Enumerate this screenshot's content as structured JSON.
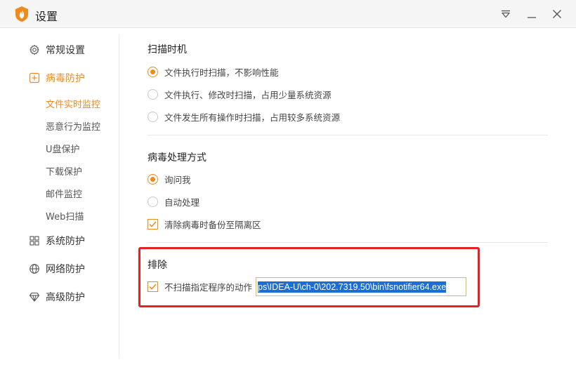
{
  "window": {
    "title": "设置",
    "colors": {
      "accent": "#f08a1c",
      "highlight_border": "#e52222",
      "selection": "#1a6fd6"
    },
    "controls": {
      "menu_icon": "dropdown-triangle-icon",
      "minimize_icon": "minimize-icon",
      "close_icon": "close-icon"
    }
  },
  "sidebar": {
    "items": [
      {
        "label": "常规设置",
        "icon": "gear-icon"
      },
      {
        "label": "病毒防护",
        "icon": "plus-shield-icon",
        "active": true
      },
      {
        "label": "系统防护",
        "icon": "grid-icon"
      },
      {
        "label": "网络防护",
        "icon": "globe-icon"
      },
      {
        "label": "高级防护",
        "icon": "diamond-icon"
      }
    ],
    "sub_items": [
      {
        "label": "文件实时监控",
        "active": true
      },
      {
        "label": "恶意行为监控"
      },
      {
        "label": "U盘保护"
      },
      {
        "label": "下载保护"
      },
      {
        "label": "邮件监控"
      },
      {
        "label": "Web扫描"
      }
    ]
  },
  "main": {
    "scan_timing": {
      "title": "扫描时机",
      "options": [
        {
          "label": "文件执行时扫描，不影响性能",
          "selected": true
        },
        {
          "label": "文件执行、修改时扫描，占用少量系统资源",
          "selected": false
        },
        {
          "label": "文件发生所有操作时扫描，占用较多系统资源",
          "selected": false
        }
      ]
    },
    "virus_handling": {
      "title": "病毒处理方式",
      "options": [
        {
          "label": "询问我",
          "selected": true
        },
        {
          "label": "自动处理",
          "selected": false
        }
      ],
      "backup_checkbox": {
        "label": "清除病毒时备份至隔离区",
        "checked": true
      }
    },
    "exclusion": {
      "title": "排除",
      "checkbox": {
        "label": "不扫描指定程序的动作",
        "checked": true
      },
      "path_value": "ps\\IDEA-U\\ch-0\\202.7319.50\\bin\\fsnotifier64.exe"
    }
  }
}
